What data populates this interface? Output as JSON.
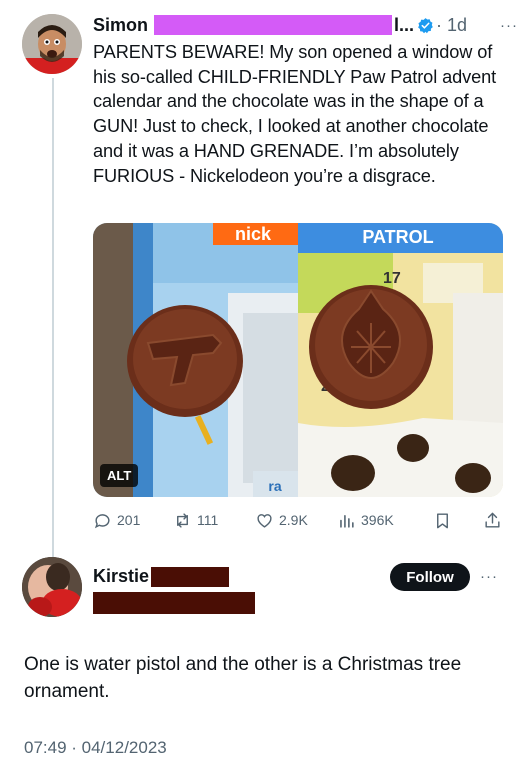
{
  "tweet": {
    "author_name": "Simon",
    "author_name_tail": "l...",
    "time": "· 1d",
    "more": "···",
    "text": "PARENTS BEWARE! My son opened a window of his so-called CHILD-FRIENDLY Paw Patrol advent calendar and the chocolate was in the shape of a GUN! Just to check, I looked at another chocolate and it was a HAND GRENADE. I’m absolutely FURIOUS - Nickelodeon you’re a disgrace.",
    "media": {
      "alt_badge": "ALT",
      "left_logo": "nick",
      "right_banner": "PATROL",
      "door_number_17": "17",
      "door_number_23": "23",
      "bottom_logo": "ra"
    },
    "actions": {
      "replies": "201",
      "reposts": "111",
      "likes": "2.9K",
      "views": "396K"
    }
  },
  "reply": {
    "author_name": "Kirstie",
    "follow_label": "Follow",
    "more": "···",
    "text": "One is water pistol and the other is a Christmas tree ornament.",
    "timestamp": "07:49 · 04/12/2023"
  },
  "colors": {
    "verified_blue": "#1d9bf0",
    "redaction_purple": "#d45bf7",
    "redaction_brown": "#4a0e05",
    "muted_text": "#536471"
  }
}
